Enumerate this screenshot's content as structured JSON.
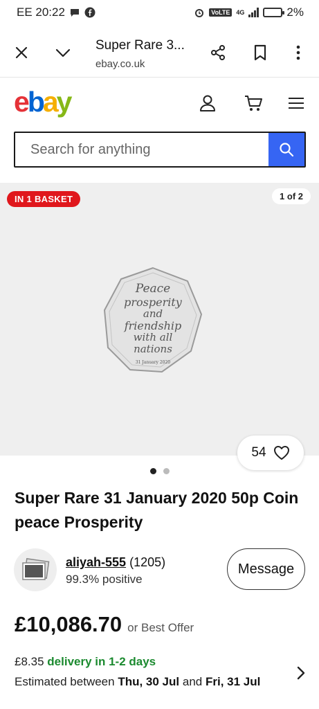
{
  "status_bar": {
    "carrier_time": "EE 20:22",
    "network": "4G",
    "volte": "VoLTE",
    "battery": "2%"
  },
  "browser": {
    "title": "Super Rare 3...",
    "url": "ebay.co.uk"
  },
  "ebay": {
    "logo": [
      "e",
      "b",
      "a",
      "y"
    ],
    "logo_colors": [
      "#e53238",
      "#0064d2",
      "#f5af02",
      "#86b817"
    ]
  },
  "search": {
    "placeholder": "Search for anything",
    "button_color": "#3665f3"
  },
  "gallery": {
    "basket_badge": "IN 1 BASKET",
    "counter": "1 of 2",
    "watch_count": "54",
    "coin_text": [
      "Peace",
      "prosperity",
      "and",
      "friendship",
      "with all",
      "nations",
      "31 January 2020"
    ]
  },
  "item": {
    "title": "Super Rare 31 January 2020 50p Coin peace Prosperity"
  },
  "seller": {
    "username": "aliyah-555",
    "feedback_count": "(1205)",
    "positive": "99.3% positive",
    "message_label": "Message"
  },
  "pricing": {
    "price": "£10,086.70",
    "note": "or Best Offer"
  },
  "delivery": {
    "cost": "£8.35",
    "speed": "delivery in 1-2 days",
    "estimate_prefix": "Estimated between",
    "date_from": "Thu, 30 Jul",
    "and": "and",
    "date_to": "Fri, 31 Jul"
  }
}
